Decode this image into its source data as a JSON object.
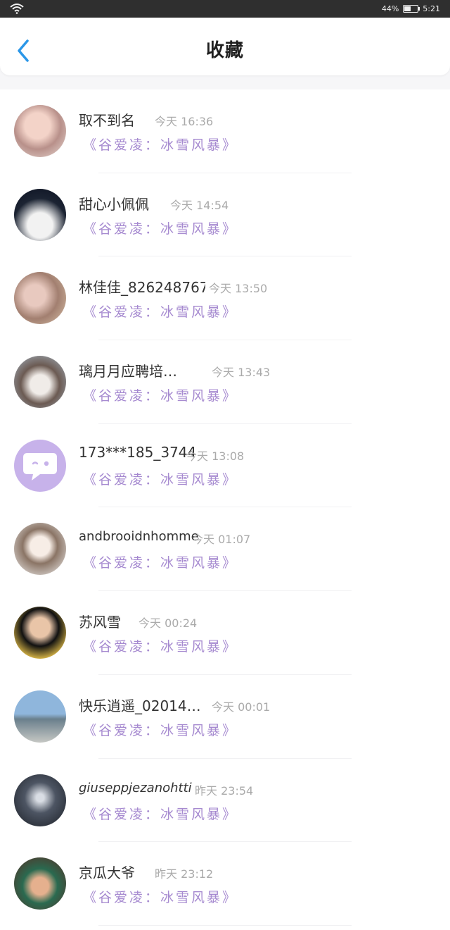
{
  "status": {
    "battery": "44%",
    "time": "5:21"
  },
  "header": {
    "title": "收藏"
  },
  "items": [
    {
      "name": "取不到名",
      "time": "今天 16:36",
      "book": "《谷爱凌：冰雪风暴》",
      "avatar": "avatar-photo"
    },
    {
      "name": "甜心小佩佩",
      "time": "今天 14:54",
      "book": "《谷爱凌：冰雪风暴》",
      "avatar": "avatar-photo"
    },
    {
      "name": "林佳佳_826248767",
      "time": "今天 13:50",
      "book": "《谷爱凌：冰雪风暴》",
      "avatar": "avatar-photo"
    },
    {
      "name": "璃月月应聘培…",
      "time": "今天 13:43",
      "book": "《谷爱凌：冰雪风暴》",
      "avatar": "avatar-photo"
    },
    {
      "name": "173***185_3744",
      "time": "今天 13:08",
      "book": "《谷爱凌：冰雪风暴》",
      "avatar": "default-chat-avatar"
    },
    {
      "name": "andbrooidnhomme",
      "time": "今天 01:07",
      "book": "《谷爱凌：冰雪风暴》",
      "avatar": "avatar-photo"
    },
    {
      "name": "苏风雪",
      "time": "今天 00:24",
      "book": "《谷爱凌：冰雪风暴》",
      "avatar": "avatar-photo"
    },
    {
      "name": "快乐逍遥_02014…",
      "time": "今天 00:01",
      "book": "《谷爱凌：冰雪风暴》",
      "avatar": "avatar-photo"
    },
    {
      "name": "giuseppjezanohtti",
      "time": "昨天 23:54",
      "book": "《谷爱凌：冰雪风暴》",
      "avatar": "avatar-photo"
    },
    {
      "name": "京瓜大爷",
      "time": "昨天 23:12",
      "book": "《谷爱凌：冰雪风暴》",
      "avatar": "avatar-photo"
    }
  ],
  "colors": {
    "accent": "#2b97e8",
    "book_title": "#a68ad0",
    "default_avatar": "#c7b2ea"
  }
}
